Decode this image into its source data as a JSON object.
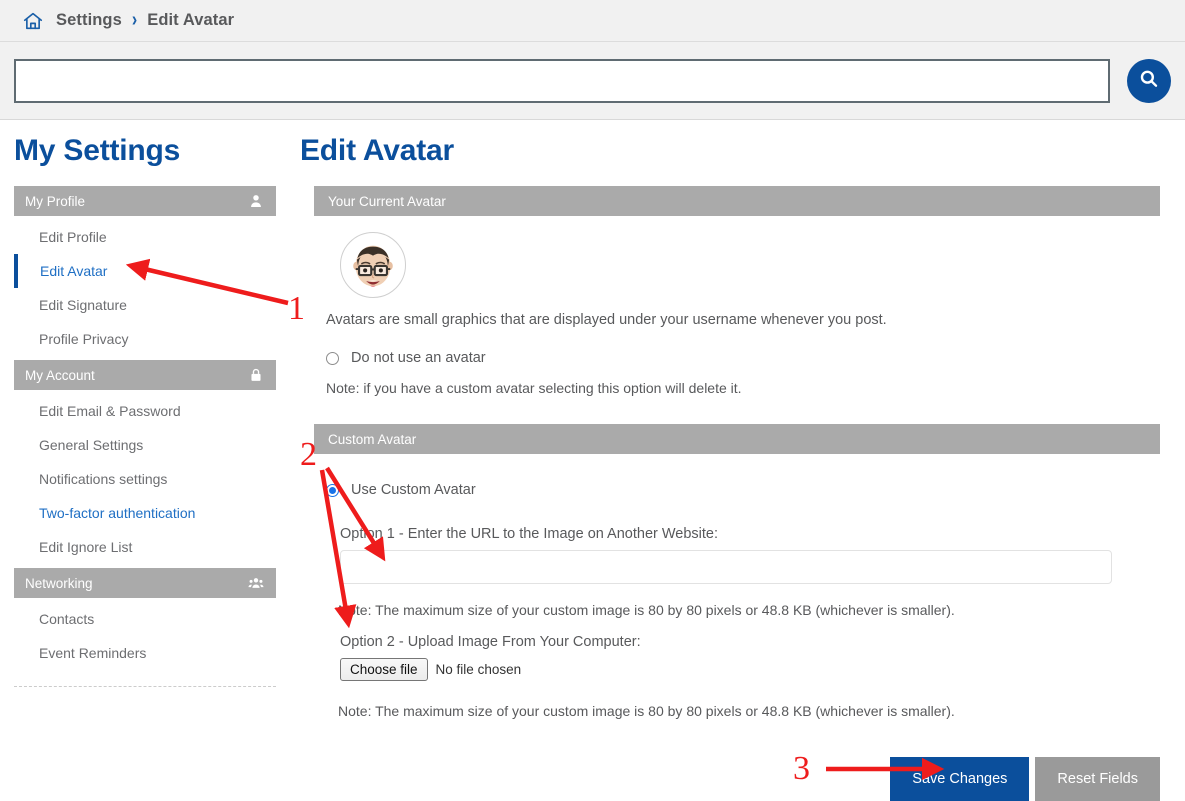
{
  "breadcrumb": {
    "home_icon": "home-icon",
    "items": [
      "Settings",
      "Edit Avatar"
    ],
    "separator": "›"
  },
  "search": {
    "value": "",
    "placeholder": "",
    "button_icon": "search-icon"
  },
  "sidebar": {
    "title": "My Settings",
    "sections": [
      {
        "header": "My Profile",
        "icon": "user-icon",
        "links": [
          {
            "label": "Edit Profile",
            "state": "normal"
          },
          {
            "label": "Edit Avatar",
            "state": "active"
          },
          {
            "label": "Edit Signature",
            "state": "normal"
          },
          {
            "label": "Profile Privacy",
            "state": "normal"
          }
        ]
      },
      {
        "header": "My Account",
        "icon": "lock-icon",
        "links": [
          {
            "label": "Edit Email & Password",
            "state": "normal"
          },
          {
            "label": "General Settings",
            "state": "normal"
          },
          {
            "label": "Notifications settings",
            "state": "normal"
          },
          {
            "label": "Two-factor authentication",
            "state": "link"
          },
          {
            "label": "Edit Ignore List",
            "state": "normal"
          }
        ]
      },
      {
        "header": "Networking",
        "icon": "people-icon",
        "links": [
          {
            "label": "Contacts",
            "state": "normal"
          },
          {
            "label": "Event Reminders",
            "state": "normal"
          }
        ]
      }
    ]
  },
  "main": {
    "title": "Edit Avatar",
    "current_avatar": {
      "panel_header": "Your Current Avatar",
      "avatar_icon": "memoji-avatar",
      "description": "Avatars are small graphics that are displayed under your username whenever you post.",
      "no_avatar_option": {
        "label": "Do not use an avatar",
        "checked": false
      },
      "no_avatar_note": "Note: if you have a custom avatar selecting this option will delete it."
    },
    "custom_avatar": {
      "panel_header": "Custom Avatar",
      "use_custom_option": {
        "label": "Use Custom Avatar",
        "checked": true
      },
      "option1_label": "Option 1 - Enter the URL to the Image on Another Website:",
      "option1_value": "",
      "option1_placeholder": "",
      "option1_note": "Note: The maximum size of your custom image is 80 by 80 pixels or 48.8 KB (whichever is smaller).",
      "option2_label": "Option 2 - Upload Image From Your Computer:",
      "choose_file_label": "Choose file",
      "file_status": "No file chosen",
      "option2_note": "Note: The maximum size of your custom image is 80 by 80 pixels or 48.8 KB (whichever is smaller)."
    },
    "buttons": {
      "save": "Save Changes",
      "reset": "Reset Fields"
    }
  },
  "annotations": {
    "color": "#ee1c1c",
    "markers": [
      {
        "number": "1",
        "target": "sidebar Edit Avatar link"
      },
      {
        "number": "2",
        "target": "custom avatar URL field and Choose file button"
      },
      {
        "number": "3",
        "target": "Save Changes button"
      }
    ]
  },
  "colors": {
    "brand_blue": "#0b4f9c",
    "panel_gray": "#aaaaaa",
    "text_gray": "#58595b",
    "annotation_red": "#ee1c1c"
  }
}
